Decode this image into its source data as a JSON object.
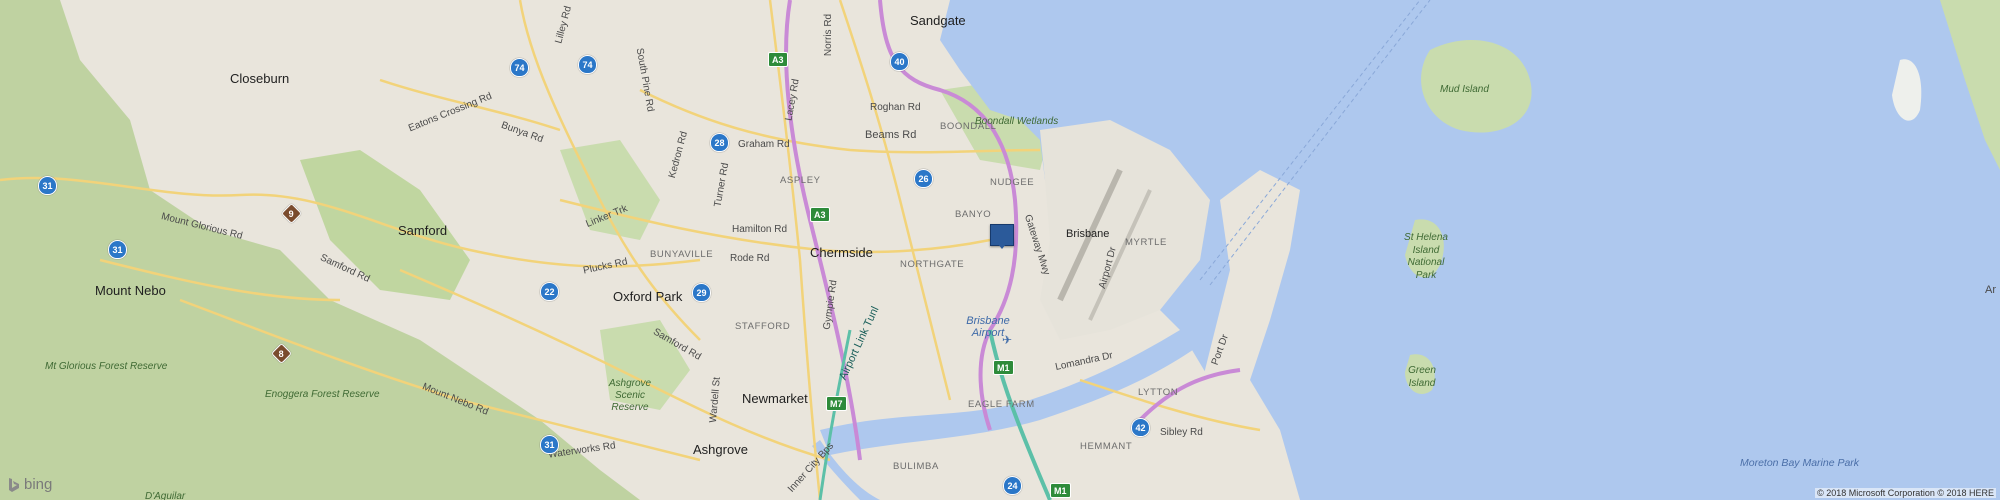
{
  "map": {
    "towns": [
      "Sandgate",
      "Closeburn",
      "Samford",
      "Mount Nebo",
      "Oxford Park",
      "Chermside",
      "Newmarket",
      "Ashgrove"
    ],
    "suburbs": [
      "BOONDALL",
      "NUDGEE",
      "ASPLEY",
      "BANYO",
      "MYRTLE",
      "BUNYAVILLE",
      "NORTHGATE",
      "STAFFORD",
      "EAGLE FARM",
      "LYTTON",
      "HEMMANT",
      "BULIMBA"
    ],
    "roads": [
      "Norris Rd",
      "Lilley Rd",
      "South Pine Rd",
      "Eatons Crossing Rd",
      "Bunya Rd",
      "Roghan Rd",
      "Beams Rd",
      "Graham Rd",
      "Kedron Rd",
      "Lacey Rd",
      "Turner Rd",
      "Hamilton Rd",
      "Rode Rd",
      "Linker Trk",
      "Mount Glorious Rd",
      "Samford Rd",
      "Plucks Rd",
      "Gateway Mwy",
      "Airport Dr",
      "Gympie Rd",
      "Airport Link Tunl",
      "Samford Rd",
      "Mount Nebo Rd",
      "Lomandra Dr",
      "Wardell St",
      "Waterworks Rd",
      "Inner City Bps",
      "Sibley Rd",
      "Port Dr"
    ],
    "parks": [
      "Boondall Wetlands",
      "Mt Glorious Forest Reserve",
      "Enoggera Forest Reserve",
      "Ashgrove Scenic Reserve",
      "Mud Island",
      "St Helena Island National Park",
      "Green Island",
      "D'Aguilar"
    ],
    "water": [
      "Moreton Bay Marine Park"
    ],
    "airport_label": "Brisbane Airport",
    "airport_name": "Brisbane",
    "edge_label": "Ar",
    "shields": {
      "blue": [
        "74",
        "74",
        "40",
        "28",
        "26",
        "31",
        "31",
        "22",
        "29",
        "31",
        "24",
        "42"
      ],
      "brown": [
        "9",
        "8"
      ],
      "alpha": [
        "A3",
        "A3",
        "M1",
        "M7",
        "M1"
      ]
    },
    "colors": {
      "water": "#aec8ee",
      "land": "#e9e5dc",
      "park": "#c9dcae",
      "forest": "#b7cf97",
      "motorway": "#c98ad6",
      "arterial": "#f2d37a",
      "marker": "#2b5a9a"
    }
  },
  "branding": {
    "logo_text": "bing",
    "copyright": "© 2018 Microsoft Corporation © 2018 HERE"
  }
}
